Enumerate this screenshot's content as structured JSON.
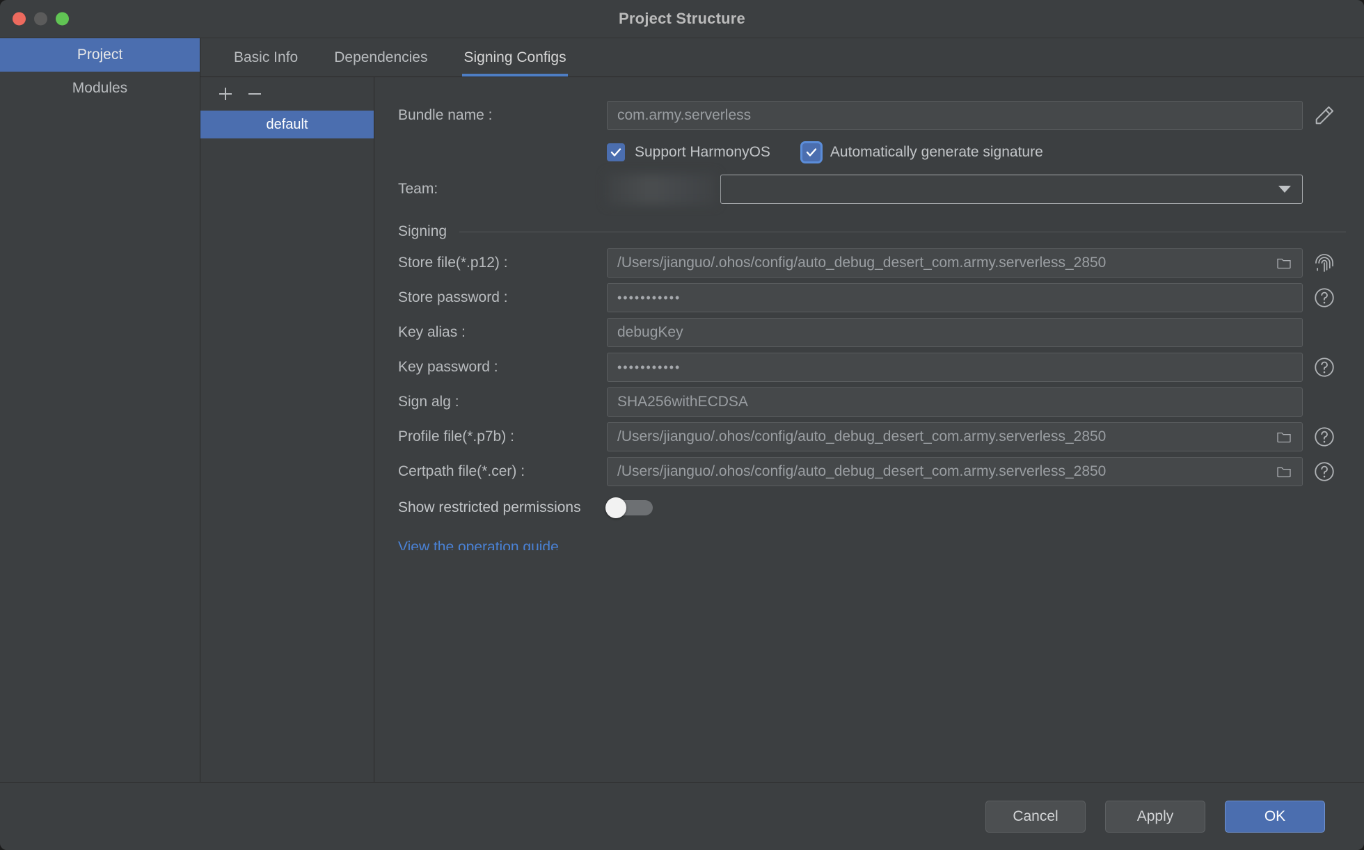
{
  "window": {
    "title": "Project Structure",
    "traffic_lights": [
      "close",
      "minimize",
      "zoom"
    ]
  },
  "sidebar": {
    "items": [
      {
        "label": "Project",
        "selected": true
      },
      {
        "label": "Modules",
        "selected": false
      }
    ]
  },
  "tabs": [
    {
      "label": "Basic Info",
      "active": false
    },
    {
      "label": "Dependencies",
      "active": false
    },
    {
      "label": "Signing Configs",
      "active": true
    }
  ],
  "configs_panel": {
    "add_label": "+",
    "remove_label": "−",
    "items": [
      {
        "label": "default",
        "selected": true
      }
    ]
  },
  "form": {
    "bundle_name": {
      "label": "Bundle name :",
      "value": "com.army.serverless",
      "edit_icon": "pencil-icon"
    },
    "checkboxes": [
      {
        "label": "Support HarmonyOS",
        "checked": true,
        "focused": false
      },
      {
        "label": "Automatically generate signature",
        "checked": true,
        "focused": true
      }
    ],
    "team": {
      "label": "Team:",
      "value": "",
      "redacted": true,
      "caret_icon": "chevron-down-icon"
    },
    "signing_section": {
      "title": "Signing"
    },
    "store_file": {
      "label": "Store file(*.p12) :",
      "value": "/Users/jianguo/.ohos/config/auto_debug_desert_com.army.serverless_2850",
      "browse_icon": "folder-icon",
      "side_icon": "fingerprint-icon"
    },
    "store_password": {
      "label": "Store password :",
      "value": "•••••••••••",
      "side_icon": "help-circle-icon"
    },
    "key_alias": {
      "label": "Key alias :",
      "value": "debugKey",
      "side_icon": ""
    },
    "key_password": {
      "label": "Key password :",
      "value": "•••••••••••",
      "side_icon": "help-circle-icon"
    },
    "sign_alg": {
      "label": "Sign alg :",
      "value": "SHA256withECDSA",
      "side_icon": ""
    },
    "profile_file": {
      "label": "Profile file(*.p7b) :",
      "value": "/Users/jianguo/.ohos/config/auto_debug_desert_com.army.serverless_2850",
      "browse_icon": "folder-icon",
      "side_icon": "help-circle-icon"
    },
    "certpath_file": {
      "label": "Certpath file(*.cer) :",
      "value": "/Users/jianguo/.ohos/config/auto_debug_desert_com.army.serverless_2850",
      "browse_icon": "folder-icon",
      "side_icon": "help-circle-icon"
    },
    "show_restricted_permissions": {
      "label": "Show restricted permissions",
      "enabled": false
    },
    "guide_link": {
      "label": "View the operation guide"
    }
  },
  "footer": {
    "cancel_label": "Cancel",
    "apply_label": "Apply",
    "ok_label": "OK"
  },
  "colors": {
    "window_bg": "#3c3f41",
    "accent": "#4b6eaf",
    "focus_ring": "#5b8dd9",
    "link": "#4a82d6",
    "text": "#b9bcbf",
    "field_bg": "#45484a",
    "tab_underline": "#4e7ec4"
  }
}
